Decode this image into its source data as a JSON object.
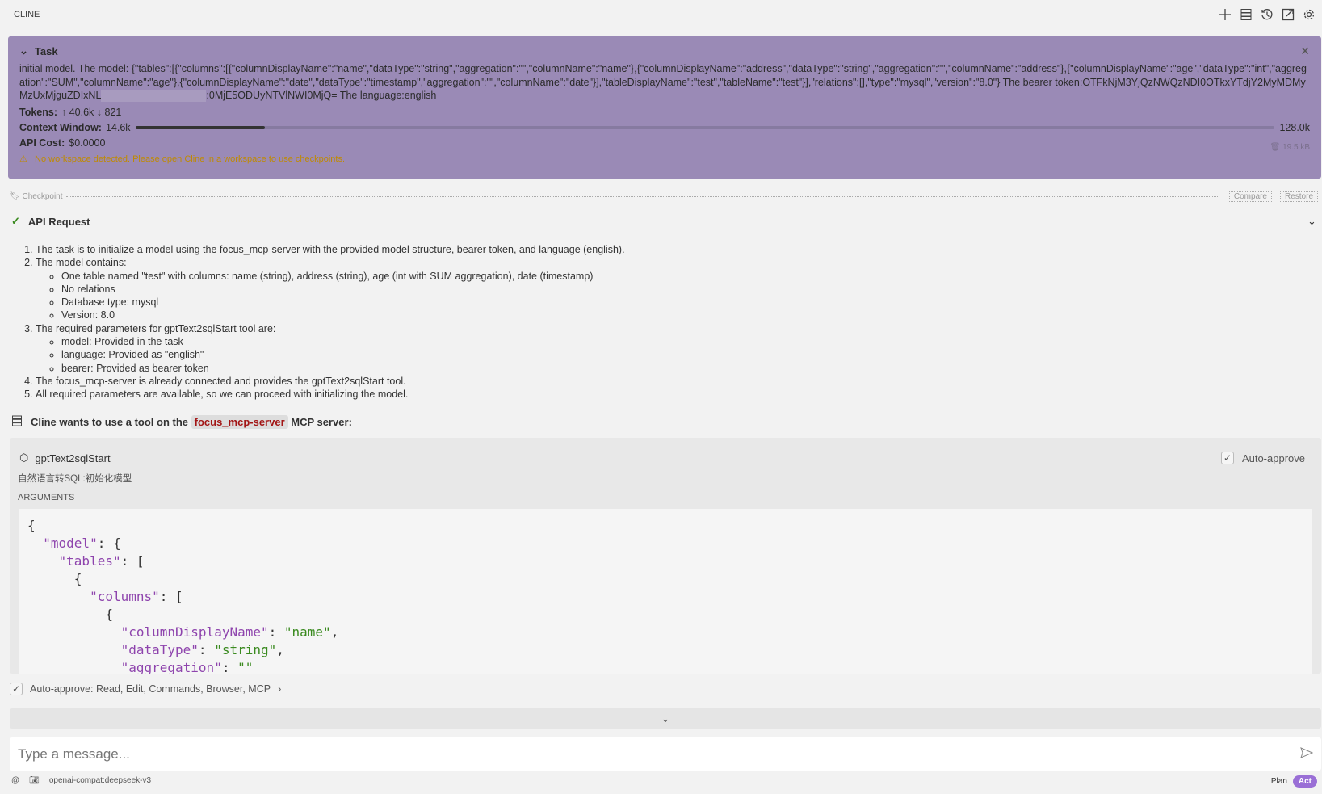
{
  "header": {
    "title": "CLINE",
    "icons": [
      "plus-icon",
      "server-icon",
      "history-icon",
      "popout-icon",
      "gear-icon"
    ]
  },
  "task": {
    "label": "Task",
    "text": "initial model. The model: {\"tables\":[{\"columns\":[{\"columnDisplayName\":\"name\",\"dataType\":\"string\",\"aggregation\":\"\",\"columnName\":\"name\"},{\"columnDisplayName\":\"address\",\"dataType\":\"string\",\"aggregation\":\"\",\"columnName\":\"address\"},{\"columnDisplayName\":\"age\",\"dataType\":\"int\",\"aggregation\":\"SUM\",\"columnName\":\"age\"},{\"columnDisplayName\":\"date\",\"dataType\":\"timestamp\",\"aggregation\":\"\",\"columnName\":\"date\"}],\"tableDisplayName\":\"test\",\"tableName\":\"test\"}],\"relations\":[],\"type\":\"mysql\",\"version\":\"8.0\"} The bearer token:OTFkNjM3YjQzNWQzNDI0OTkxYTdjY2MyMDMyMzUxMjguZDIxNL",
    "text_end": ":0MjE5ODUyNTVlNWI0MjQ= The language:english",
    "tokens_label": "Tokens:",
    "tokens_up": "↑ 40.6k",
    "tokens_down": "↓ 821",
    "context_label": "Context Window:",
    "context_used": "14.6k",
    "context_max": "128.0k",
    "context_fraction": 0.114,
    "cost_label": "API Cost:",
    "cost": "$0.0000",
    "size": "19.5 kB",
    "warning": "No workspace detected. Please open Cline in a workspace to use checkpoints."
  },
  "checkpoint": {
    "label": "Checkpoint",
    "compare": "Compare",
    "restore": "Restore"
  },
  "api_request": {
    "title": "API Request",
    "items": [
      {
        "text": "The task is to initialize a model using the focus_mcp-server with the provided model structure, bearer token, and language (english).",
        "sub": []
      },
      {
        "text": "The model contains:",
        "sub": [
          "One table named \"test\" with columns: name (string), address (string), age (int with SUM aggregation), date (timestamp)",
          "No relations",
          "Database type: mysql",
          "Version: 8.0"
        ]
      },
      {
        "text": "The required parameters for gptText2sqlStart tool are:",
        "sub": [
          "model: Provided in the task",
          "language: Provided as \"english\"",
          "bearer: Provided as bearer token"
        ]
      },
      {
        "text": "The focus_mcp-server is already connected and provides the gptText2sqlStart tool.",
        "sub": []
      },
      {
        "text": "All required parameters are available, so we can proceed with initializing the model.",
        "sub": []
      }
    ]
  },
  "mcp": {
    "prefix": "Cline wants to use a tool on the",
    "server": "focus_mcp-server",
    "suffix": "MCP server:"
  },
  "tool": {
    "name": "gptText2sqlStart",
    "description": "自然语言转SQL:初始化模型",
    "auto_approve": "Auto-approve",
    "arguments_label": "ARGUMENTS",
    "code": [
      [
        "{"
      ],
      [
        "  ",
        [
          "k",
          "\"model\""
        ],
        ": {"
      ],
      [
        "    ",
        [
          "k",
          "\"tables\""
        ],
        ": ["
      ],
      [
        "      {"
      ],
      [
        "        ",
        [
          "k",
          "\"columns\""
        ],
        ": ["
      ],
      [
        "          {"
      ],
      [
        "            ",
        [
          "k",
          "\"columnDisplayName\""
        ],
        ": ",
        [
          "s",
          "\"name\""
        ],
        ","
      ],
      [
        "            ",
        [
          "k",
          "\"dataType\""
        ],
        ": ",
        [
          "s",
          "\"string\""
        ],
        ","
      ],
      [
        "            ",
        [
          "k",
          "\"aggregation\""
        ],
        ": ",
        [
          "s",
          "\"\""
        ]
      ]
    ]
  },
  "auto_approve": {
    "label": "Auto-approve:",
    "value": "Read, Edit, Commands, Browser, MCP"
  },
  "input": {
    "placeholder": "Type a message..."
  },
  "footer": {
    "model": "openai-compat:deepseek-v3",
    "plan": "Plan",
    "act": "Act"
  }
}
